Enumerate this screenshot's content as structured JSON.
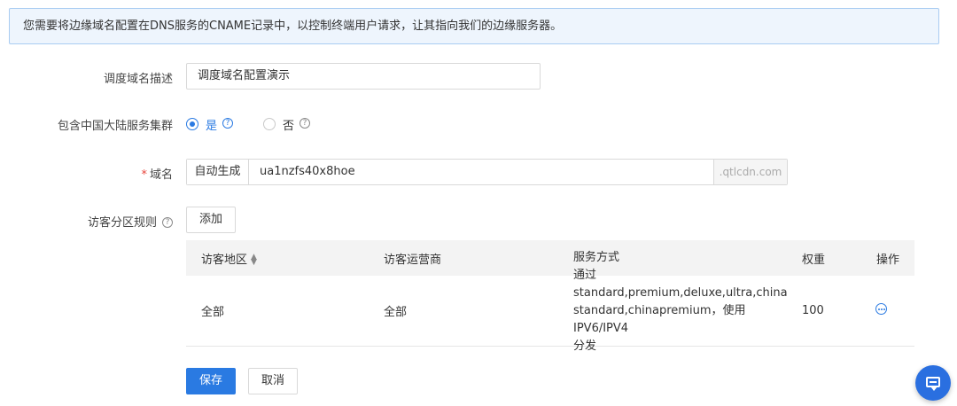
{
  "alert": {
    "text": "您需要将边缘域名配置在DNS服务的CNAME记录中，以控制终端用户请求，让其指向我们的边缘服务器。"
  },
  "form": {
    "description": {
      "label": "调度域名描述",
      "value": "调度域名配置演示"
    },
    "mainland": {
      "label": "包含中国大陆服务集群",
      "options": [
        {
          "label": "是",
          "selected": true
        },
        {
          "label": "否",
          "selected": false
        }
      ]
    },
    "domain": {
      "required_mark": "*",
      "label": "域名",
      "prefix": "自动生成",
      "value": "ua1nzfs40x8hoe",
      "suffix": ".qtlcdn.com"
    },
    "rules": {
      "label": "访客分区规则",
      "add_label": "添加"
    }
  },
  "table": {
    "headers": [
      "访客地区",
      "访客运营商",
      "服务方式",
      "权重",
      "操作"
    ],
    "rows": [
      {
        "region": "全部",
        "isp": "全部",
        "service_lines": [
          "通过 standard,premium,deluxe,ultra,china",
          "standard,chinapremium，使用IPV6/IPV4",
          "分发"
        ],
        "weight": "100",
        "action_icon": "more-icon"
      }
    ]
  },
  "footer": {
    "save_label": "保存",
    "cancel_label": "取消"
  },
  "help_icon_glyph": "?",
  "colors": {
    "primary": "#2a7ae2",
    "alert_bg": "#eef5fd",
    "alert_border": "#a9ccf2",
    "required": "#e8453c"
  }
}
